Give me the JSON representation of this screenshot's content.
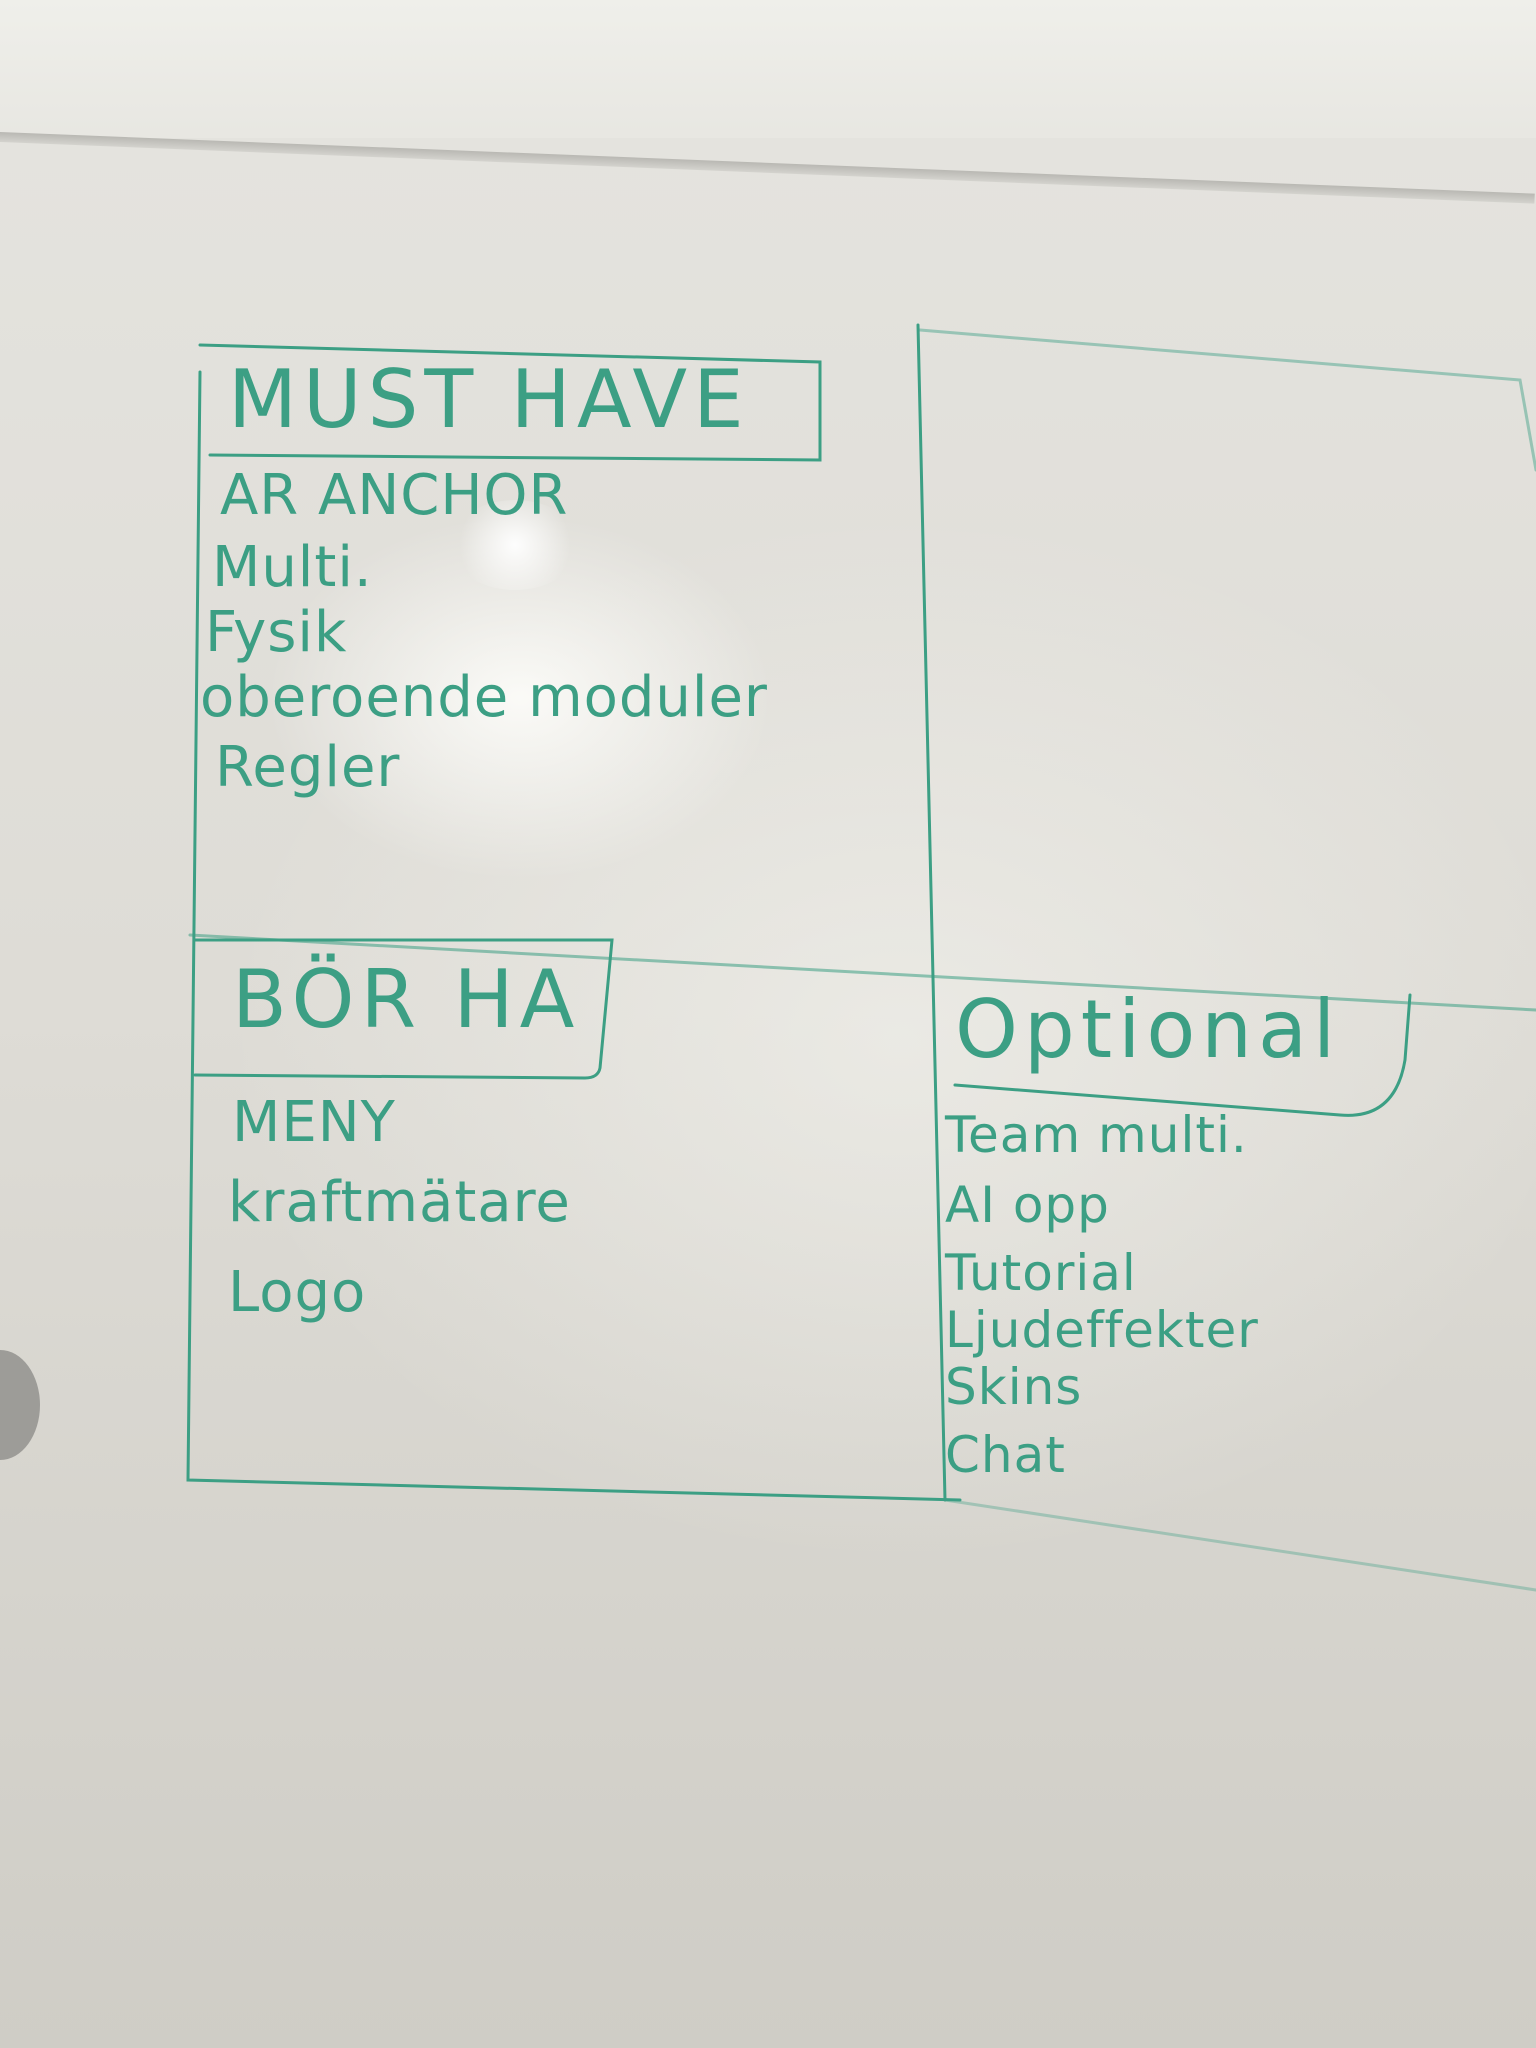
{
  "whiteboard": {
    "must_have": {
      "heading": "MUST HAVE",
      "items": [
        "AR ANCHOR",
        "Multi.",
        "Fysik",
        "oberoende moduler",
        "Regler"
      ]
    },
    "bor_ha": {
      "heading": "BÖR HA",
      "items": [
        "MENY",
        "kraftmätare",
        "Logo"
      ]
    },
    "optional": {
      "heading": "Optional",
      "items": [
        "Team multi.",
        "AI opp",
        "Tutorial",
        "Ljudeffekter",
        "Skins",
        "Chat"
      ]
    }
  },
  "colors": {
    "marker": "#3c9f84",
    "board": "#e4e3de"
  }
}
